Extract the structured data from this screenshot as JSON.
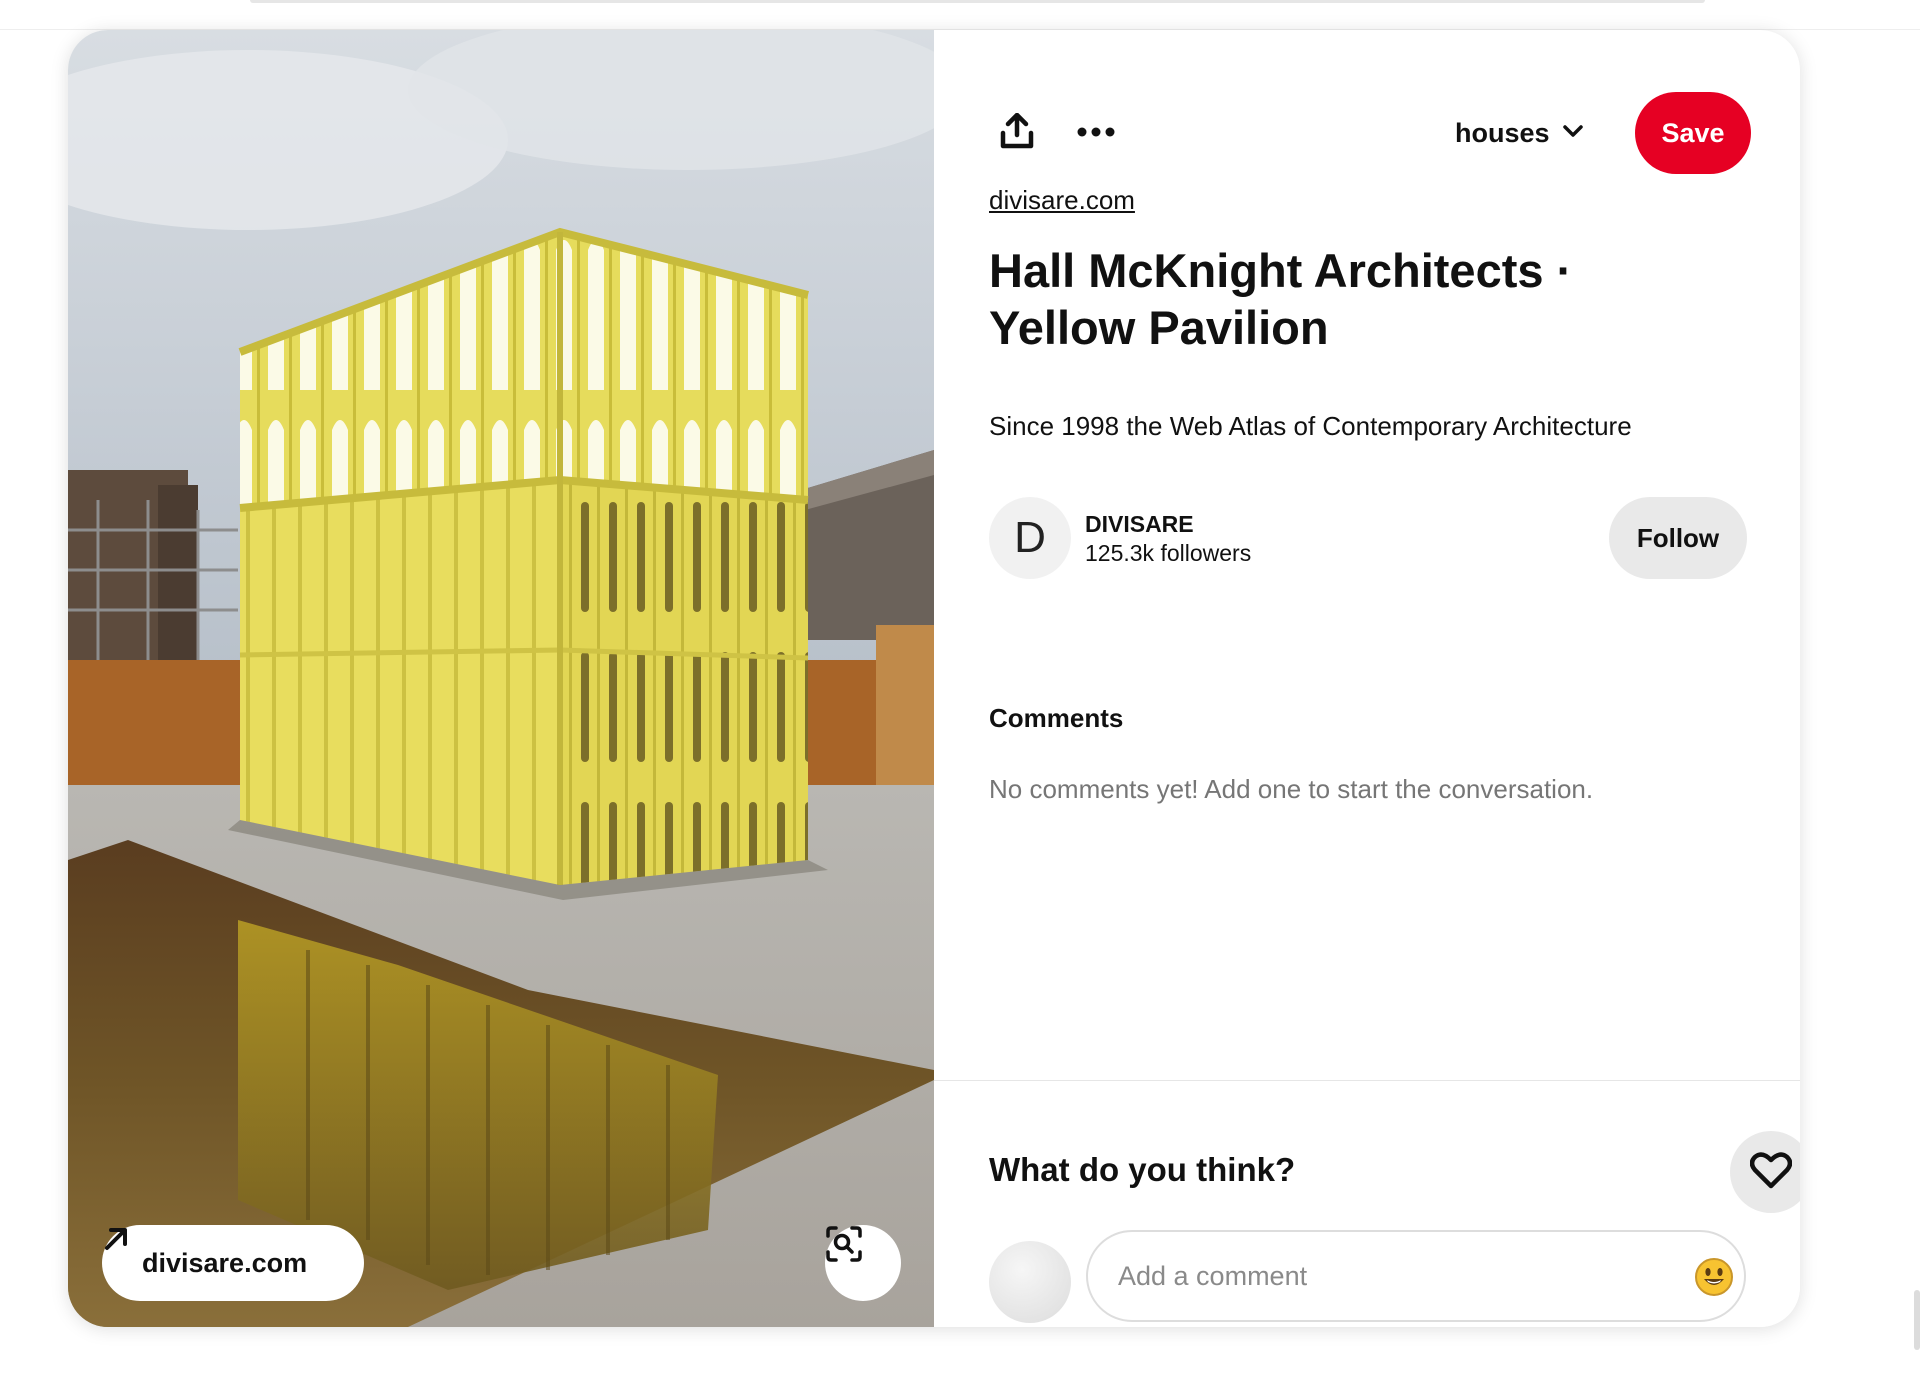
{
  "pin": {
    "source_domain": "divisare.com",
    "title": "Hall McKnight Architects · Yellow Pavilion",
    "description": "Since 1998 the Web Atlas of Contemporary Architecture",
    "image_alt": "Yellow pavilion with arched frames beside a reflecting pool"
  },
  "toolbar": {
    "share_icon": "share-upload-icon",
    "more_icon": "more-dots-icon",
    "board_name": "houses",
    "save_label": "Save"
  },
  "visit_link": {
    "label": "divisare.com",
    "icon": "arrow-up-right-icon"
  },
  "creator": {
    "avatar_letter": "D",
    "name": "DIVISARE",
    "followers": "125.3k followers",
    "follow_label": "Follow"
  },
  "comments": {
    "heading": "Comments",
    "empty_text": "No comments yet! Add one to start the conversation."
  },
  "composer": {
    "title": "What do you think?",
    "placeholder": "Add a comment",
    "emoji": "😃"
  },
  "colors": {
    "brand_red": "#e60023",
    "pavilion_yellow": "#e9df5a",
    "button_grey": "#e9e9e9"
  }
}
